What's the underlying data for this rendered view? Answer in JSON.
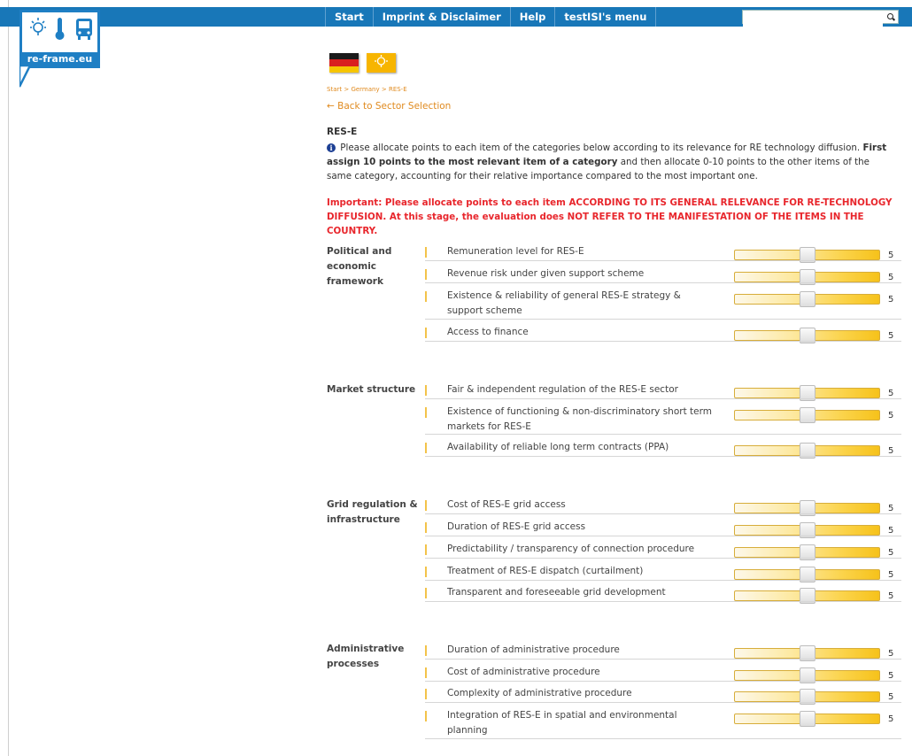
{
  "nav": {
    "items": [
      "Start",
      "Imprint & Disclaimer",
      "Help",
      "testISI's menu"
    ],
    "search_placeholder": ""
  },
  "logo": {
    "text": "re-frame.eu",
    "icons": [
      "bulb-icon",
      "thermometer-icon",
      "bus-icon"
    ],
    "color": "#1f7fc4"
  },
  "flags": {
    "country": "germany-flag-icon",
    "sector": "res-e-sector-icon"
  },
  "breadcrumb": [
    "Start",
    "Germany",
    "RES-E"
  ],
  "back_link": "← Back to Sector Selection",
  "page_title": "RES-E",
  "intro": {
    "text_1": "Please allocate points to each item of the categories below according to its relevance for RE technology diffusion.",
    "text_bold": "First assign 10 points to the most relevant item of a category",
    "text_2": "and then allocate 0-10 points to the other items of the same category, accounting for their relative importance compared to the most important one."
  },
  "important": "Important: Please allocate points to each item ACCORDING TO ITS GENERAL RELEVANCE FOR RE-TECHNOLOGY DIFFUSION. At this stage, the evaluation does NOT REFER TO THE MANIFESTATION OF THE ITEMS IN THE COUNTRY.",
  "slider_scale": {
    "min": 0,
    "max": 10
  },
  "categories": [
    {
      "label": "Political and economic framework",
      "items": [
        {
          "label": "Remuneration level for RES-E",
          "value": "5"
        },
        {
          "label": "Revenue risk under given support scheme",
          "value": "5"
        },
        {
          "label": "Existence & reliability of general RES-E strategy & support scheme",
          "value": "5"
        },
        {
          "label": "Access to finance",
          "value": "5"
        }
      ]
    },
    {
      "label": "Market structure",
      "items": [
        {
          "label": "Fair & independent regulation of the RES-E sector",
          "value": "5"
        },
        {
          "label": "Existence of functioning & non-discriminatory short term markets for RES-E",
          "value": "5"
        },
        {
          "label": "Availability of reliable long term contracts (PPA)",
          "value": "5"
        }
      ]
    },
    {
      "label": "Grid regulation & infrastructure",
      "items": [
        {
          "label": "Cost of RES-E grid access",
          "value": "5"
        },
        {
          "label": "Duration of RES-E grid access",
          "value": "5"
        },
        {
          "label": "Predictability / transparency of connection procedure",
          "value": "5"
        },
        {
          "label": "Treatment of RES-E dispatch (curtailment)",
          "value": "5"
        },
        {
          "label": "Transparent and foreseeable grid development",
          "value": "5"
        }
      ]
    },
    {
      "label": "Administrative processes",
      "items": [
        {
          "label": "Duration of administrative procedure",
          "value": "5"
        },
        {
          "label": "Cost of administrative procedure",
          "value": "5"
        },
        {
          "label": "Complexity of administrative procedure",
          "value": "5"
        },
        {
          "label": "Integration of RES-E in spatial and environmental planning",
          "value": "5"
        }
      ]
    }
  ]
}
